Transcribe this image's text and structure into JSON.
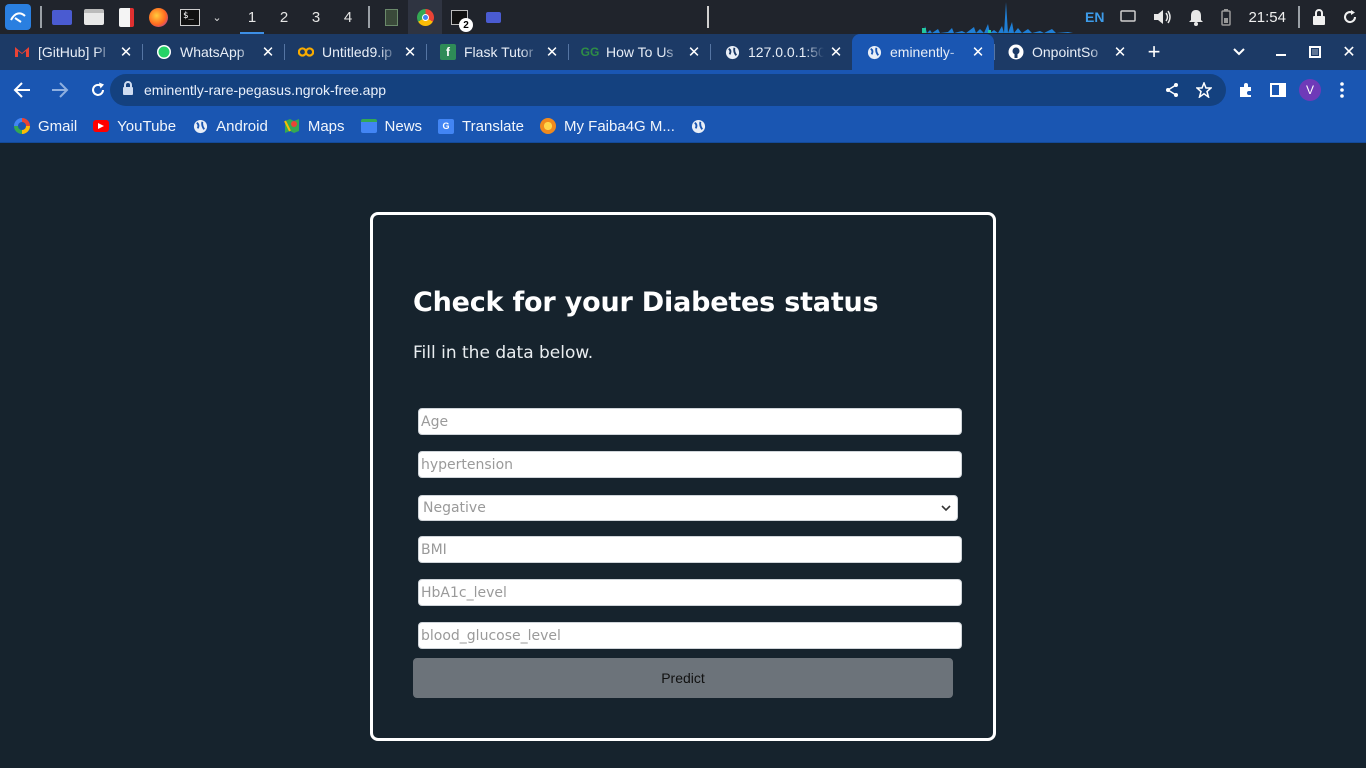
{
  "taskbar": {
    "workspaces": [
      "1",
      "2",
      "3",
      "4"
    ],
    "terminal_badge": "2",
    "language": "EN",
    "clock": "21:54"
  },
  "tabs": [
    {
      "title": "[GitHub] Pl",
      "icon": "gmail-icon"
    },
    {
      "title": "WhatsApp",
      "icon": "whatsapp-icon"
    },
    {
      "title": "Untitled9.ip",
      "icon": "colab-icon"
    },
    {
      "title": "Flask Tutor",
      "icon": "flask-icon"
    },
    {
      "title": "How To Us",
      "icon": "geeksforgeeks-icon"
    },
    {
      "title": "127.0.0.1:50",
      "icon": "globe-icon"
    },
    {
      "title": "eminently-",
      "icon": "globe-icon"
    },
    {
      "title": "OnpointSo",
      "icon": "github-icon"
    }
  ],
  "toolbar": {
    "url": "eminently-rare-pegasus.ngrok-free.app",
    "profile_initial": "V"
  },
  "bookmarks": [
    {
      "label": "Gmail",
      "icon": "google-icon"
    },
    {
      "label": "YouTube",
      "icon": "youtube-icon"
    },
    {
      "label": "Android",
      "icon": "globe-icon"
    },
    {
      "label": "Maps",
      "icon": "maps-icon"
    },
    {
      "label": "News",
      "icon": "news-icon"
    },
    {
      "label": "Translate",
      "icon": "translate-icon"
    },
    {
      "label": "My Faiba4G M...",
      "icon": "faiba-icon"
    }
  ],
  "form": {
    "title": "Check for your Diabetes status",
    "subtitle": "Fill in the data below.",
    "age_placeholder": "Age",
    "hypertension_placeholder": "hypertension",
    "heart_disease_selected": "Negative",
    "bmi_placeholder": "BMI",
    "hba1c_placeholder": "HbA1c_level",
    "glucose_placeholder": "blood_glucose_level",
    "submit_label": "Predict"
  },
  "colors": {
    "page_background": "#16232d",
    "browser_accent": "#1a56b2",
    "button_gray": "#6c737a"
  }
}
